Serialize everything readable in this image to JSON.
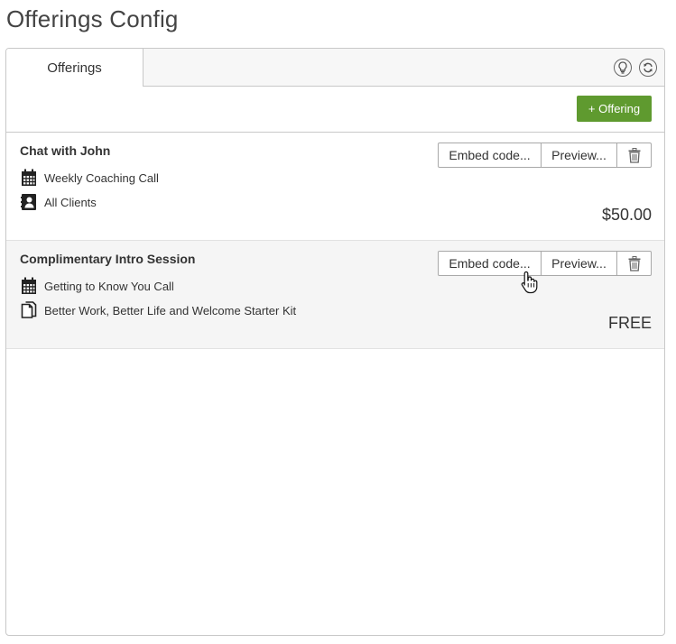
{
  "page": {
    "title": "Offerings Config"
  },
  "tabs": [
    {
      "label": "Offerings"
    }
  ],
  "toolbar": {
    "add_offering_label": "+ Offering"
  },
  "offerings": [
    {
      "title": "Chat with John",
      "details": [
        {
          "icon": "calendar-icon",
          "text": "Weekly Coaching Call"
        },
        {
          "icon": "contact-card-icon",
          "text": "All Clients"
        }
      ],
      "price": "$50.00",
      "embed_label": "Embed code...",
      "preview_label": "Preview..."
    },
    {
      "title": "Complimentary Intro Session",
      "details": [
        {
          "icon": "calendar-icon",
          "text": "Getting to Know You Call"
        },
        {
          "icon": "documents-icon",
          "text": "Better Work, Better Life and Welcome Starter Kit"
        }
      ],
      "price": "FREE",
      "embed_label": "Embed code...",
      "preview_label": "Preview..."
    }
  ],
  "colors": {
    "primary_green": "#5f9a2f",
    "border": "#c8c8c8",
    "row_alt": "#f5f5f5"
  }
}
